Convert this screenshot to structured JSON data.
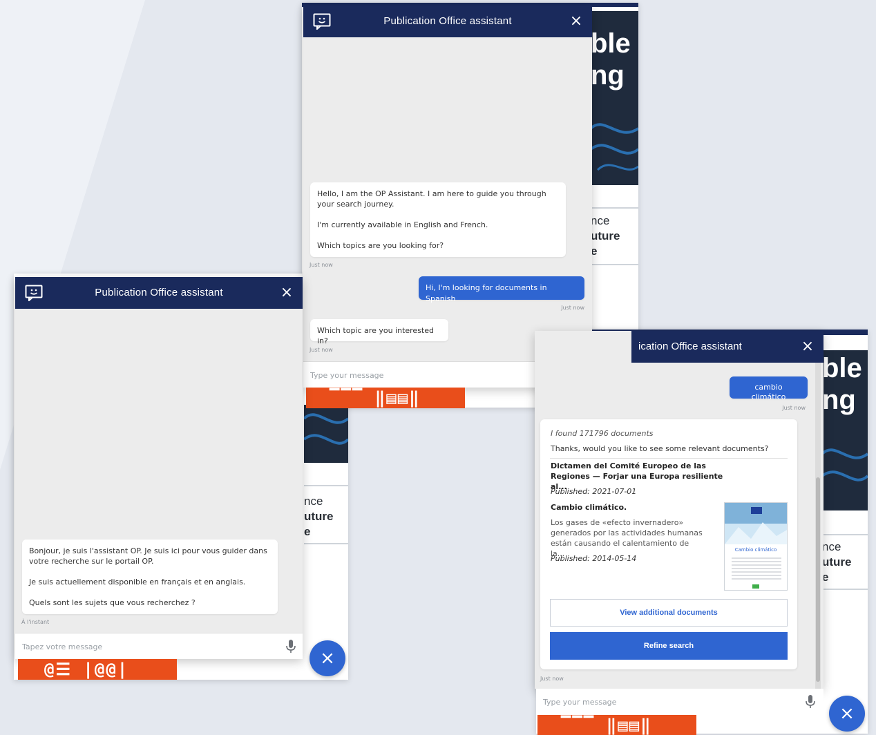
{
  "background": {
    "color": "#eef1f6"
  },
  "backdrop_page": {
    "hero_text_line1": "ble",
    "hero_text_line2": "ng",
    "card_line1": "nce",
    "card_line2": "uture",
    "card_line3": "e"
  },
  "windows": {
    "french": {
      "title": "Publication Office assistant",
      "messages": [
        {
          "from": "bot",
          "paragraphs": [
            "Bonjour, je suis l'assistant OP. Je suis ici pour vous guider dans votre recherche sur le portail OP.",
            "Je suis actuellement disponible en français et en anglais.",
            "Quels sont les sujets que vous recherchez ?"
          ],
          "time": "À l'instant"
        }
      ],
      "input_placeholder": "Tapez votre message"
    },
    "english": {
      "title": "Publication Office assistant",
      "messages": [
        {
          "from": "bot",
          "paragraphs": [
            "Hello, I am the OP Assistant. I am here to guide you through your search journey.",
            "I'm currently available in English and French.",
            "Which topics are you looking for?"
          ],
          "time": "Just now"
        },
        {
          "from": "user",
          "text": "Hi, I'm looking for documents in Spanish",
          "time": "Just now"
        },
        {
          "from": "bot",
          "text": "Which topic are you interested in?",
          "time": "Just now"
        }
      ],
      "input_placeholder": "Type your message"
    },
    "results": {
      "title": "Publication Office assistant",
      "title_visible": "ication Office assistant",
      "user_message": "cambio climático",
      "user_time": "Just now",
      "found_text": "I found 171796 documents",
      "thanks_text": "Thanks, would you like to see some relevant documents?",
      "documents": [
        {
          "title": "Dictamen del Comité Europeo de las Regiones — Forjar una Europa resiliente al...",
          "published": "Published: 2021-07-01"
        },
        {
          "title": "Cambio climático.",
          "description": "Los gases de «efecto invernadero» generados por las actividades humanas están causando el calentamiento de la...",
          "published": "Published: 2014-05-14",
          "thumbnail_label": "Cambio climático"
        }
      ],
      "view_more_label": "View additional documents",
      "refine_label": "Refine search",
      "results_time": "Just now",
      "input_placeholder": "Type your message"
    }
  },
  "icons": {
    "close": "×",
    "fab_close": "×"
  },
  "colors": {
    "header": "#1a2a5c",
    "accent": "#2f65d1",
    "orange": "#e94e1b"
  }
}
